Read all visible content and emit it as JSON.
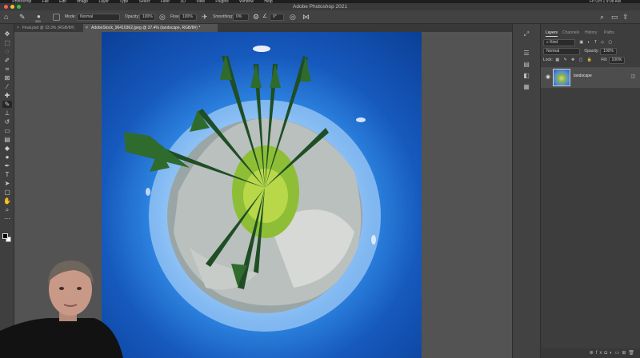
{
  "menubar": {
    "items": [
      "Photoshop",
      "File",
      "Edit",
      "Image",
      "Layer",
      "Type",
      "Select",
      "Filter",
      "3D",
      "View",
      "Plugins",
      "Window",
      "Help"
    ],
    "clock": "Fri Oct 1  9:08 AM"
  },
  "window": {
    "title": "Adobe Photoshop 2021"
  },
  "options": {
    "brush_size": "200",
    "mode_label": "Mode:",
    "mode_value": "Normal",
    "opacity_label": "Opacity:",
    "opacity_value": "100%",
    "flow_label": "Flow:",
    "flow_value": "100%",
    "smoothing_label": "Smoothing:",
    "smoothing_value": "0%",
    "angle_value": "0°"
  },
  "tabs": [
    {
      "label": "Final.psd @ 33.3% (RGB/8#)",
      "active": false
    },
    {
      "label": "AdobeStock_96410362.jpeg @ 37.4% (landscape, RGB/8#) *",
      "active": true
    }
  ],
  "layers_panel": {
    "tabs": [
      "Layers",
      "Channels",
      "History",
      "Paths"
    ],
    "kind_label": "Kind",
    "blend_mode": "Normal",
    "opacity_label": "Opacity:",
    "opacity_value": "100%",
    "lock_label": "Lock:",
    "fill_label": "Fill:",
    "fill_value": "100%",
    "layer_name": "landscape"
  },
  "icons": {
    "tools": [
      "move-icon",
      "marquee-icon",
      "lasso-icon",
      "quick-select-icon",
      "crop-icon",
      "frame-icon",
      "eyedropper-icon",
      "healing-icon",
      "brush-icon",
      "stamp-icon",
      "history-brush-icon",
      "eraser-icon",
      "gradient-icon",
      "blur-icon",
      "dodge-icon",
      "pen-icon",
      "type-icon",
      "path-select-icon",
      "shape-icon",
      "hand-icon",
      "zoom-icon",
      "more-icon"
    ],
    "panel_side": [
      "adjust-icon",
      "properties-icon",
      "libraries-icon",
      "layers-panel-icon",
      "swatches-icon"
    ]
  },
  "colors": {
    "foreground": "#000000",
    "background": "#ffffff"
  }
}
